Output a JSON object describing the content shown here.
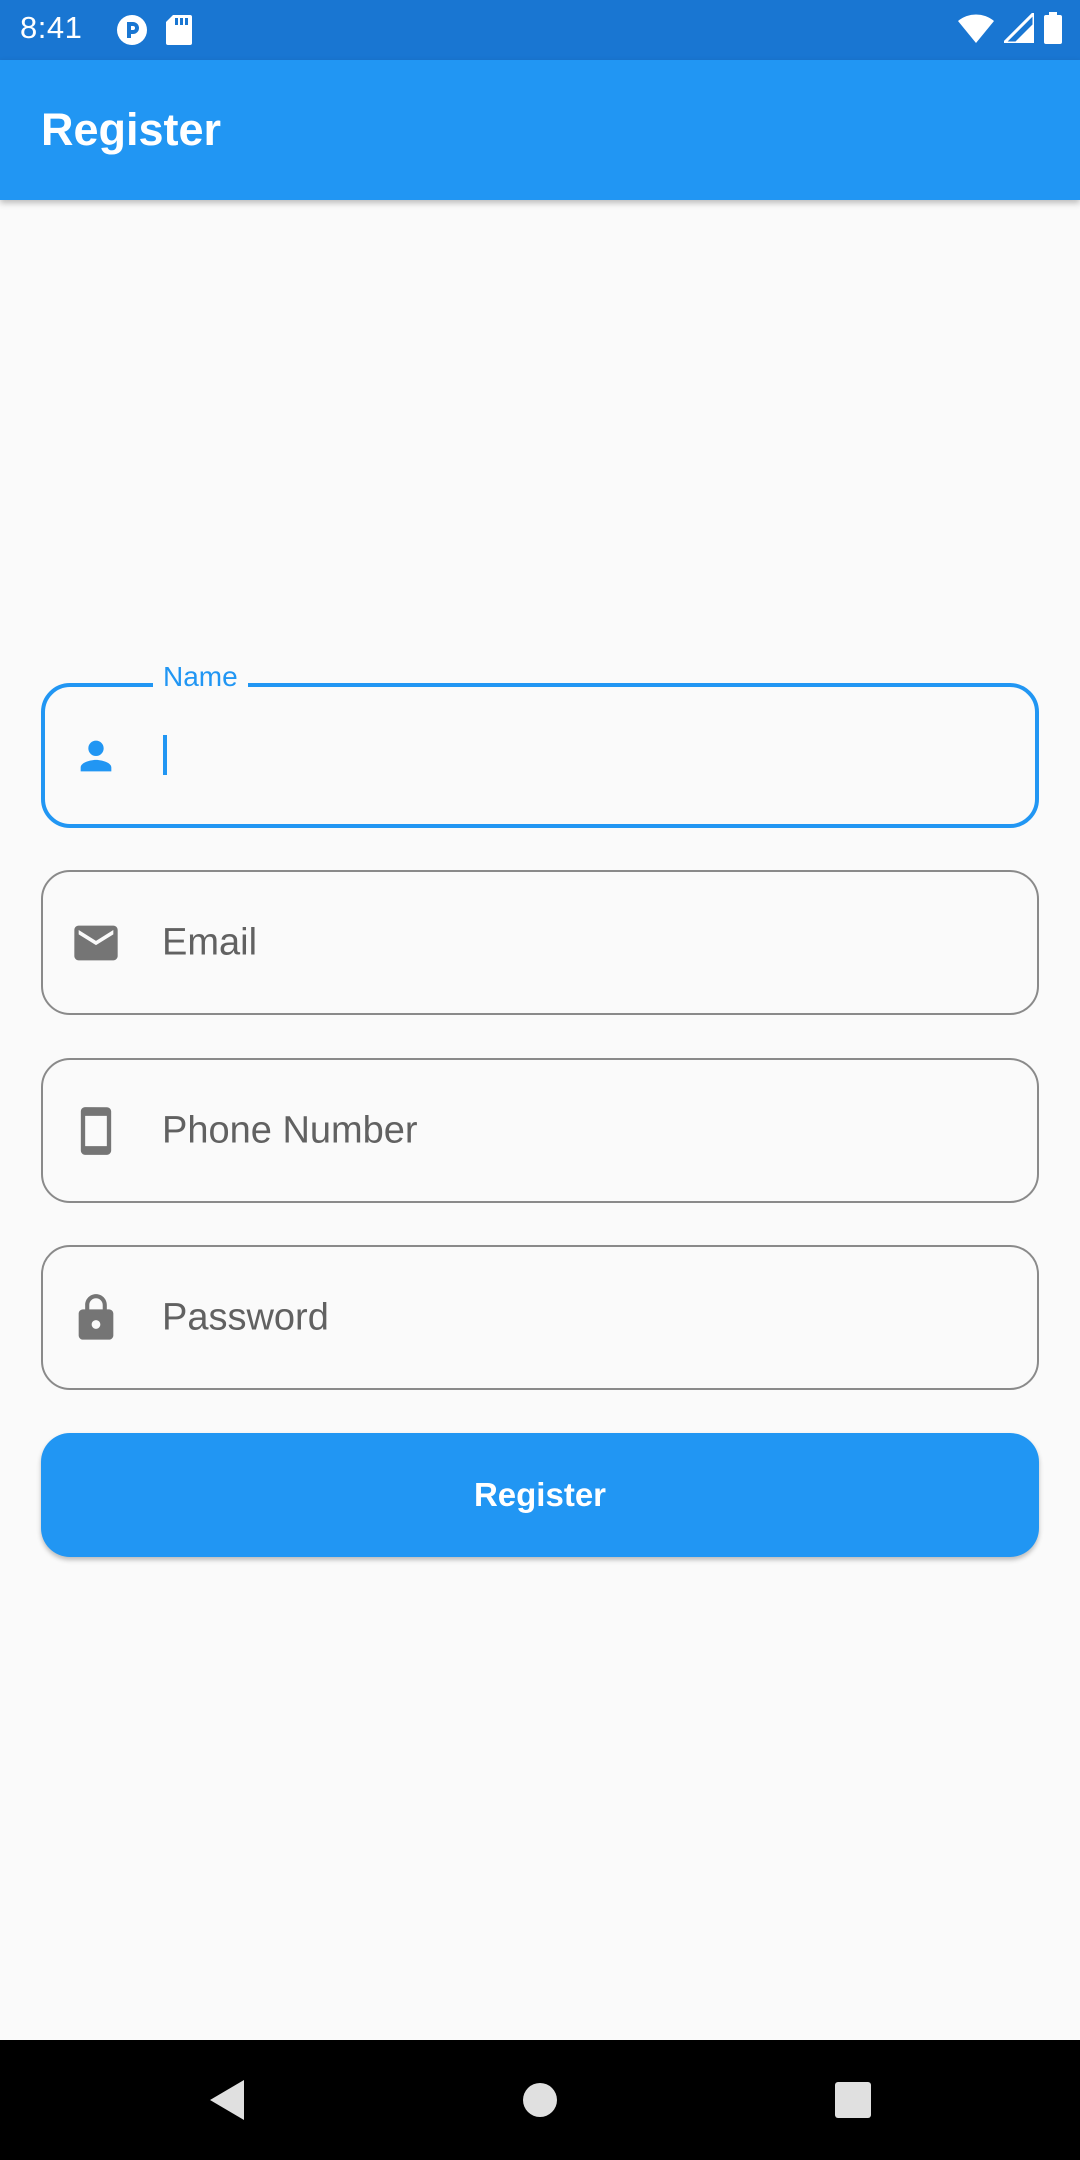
{
  "status_bar": {
    "time": "8:41",
    "left_icons": [
      "pocket-casts-icon",
      "sd-card-icon"
    ],
    "right_icons": [
      "wifi-icon",
      "cell-signal-icon",
      "battery-icon"
    ]
  },
  "app_bar": {
    "title": "Register"
  },
  "form": {
    "name": {
      "label": "Name",
      "value": "",
      "icon": "person-icon"
    },
    "email": {
      "placeholder": "Email",
      "icon": "mail-icon"
    },
    "phone": {
      "placeholder": "Phone Number",
      "icon": "smartphone-icon"
    },
    "password": {
      "placeholder": "Password",
      "icon": "lock-icon"
    }
  },
  "register_button": {
    "label": "Register"
  },
  "navigation": {
    "buttons": [
      "back-icon",
      "home-icon",
      "recents-icon"
    ]
  },
  "colors": {
    "primary": "#2196f3",
    "primary_dark": "#1976d2",
    "background": "#fafafa",
    "border": "#8a8a8a",
    "icon_gray": "#757575"
  }
}
